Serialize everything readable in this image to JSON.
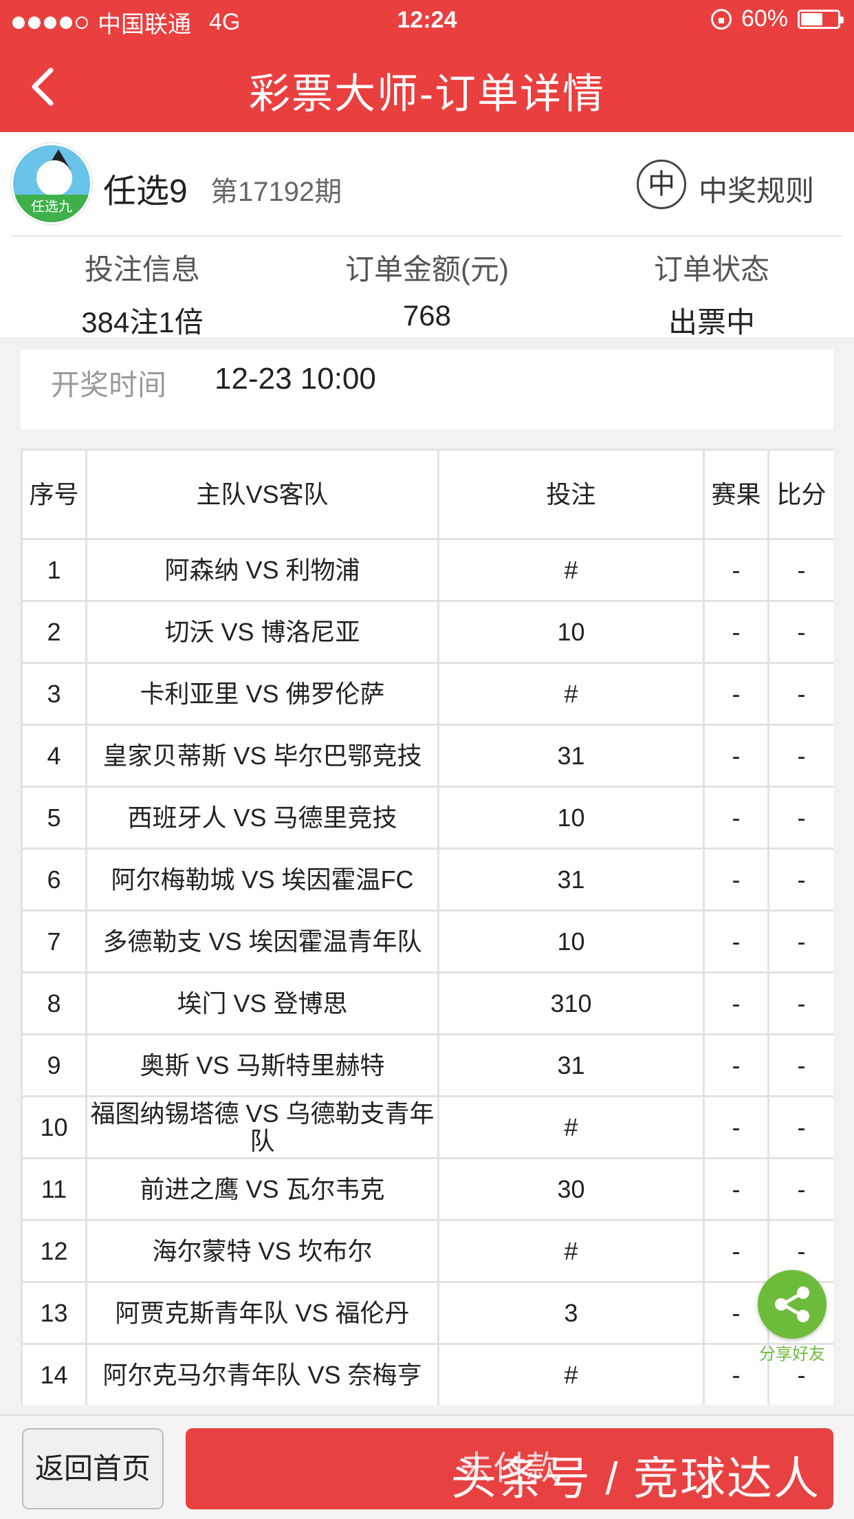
{
  "status_bar": {
    "carrier": "中国联通",
    "network": "4G",
    "time": "12:24",
    "battery": "60%",
    "battery_level": 0.6
  },
  "header": {
    "title": "彩票大师-订单详情"
  },
  "game": {
    "name": "任选9",
    "period": "第17192期",
    "rule_badge": "中",
    "rule_label": "中奖规则",
    "avatar_band_text": "任选九"
  },
  "order": {
    "bet_info_label": "投注信息",
    "bet_info_value": "384注1倍",
    "amount_label": "订单金额(元)",
    "amount_value": "768",
    "status_label": "订单状态",
    "status_value": "出票中"
  },
  "draw": {
    "label": "开奖时间",
    "value": "12-23 10:00"
  },
  "table": {
    "headers": [
      "序号",
      "主队VS客队",
      "投注",
      "赛果",
      "比分"
    ],
    "rows": [
      [
        "1",
        "阿森纳 VS 利物浦",
        "#",
        "-",
        "-"
      ],
      [
        "2",
        "切沃 VS 博洛尼亚",
        "10",
        "-",
        "-"
      ],
      [
        "3",
        "卡利亚里 VS 佛罗伦萨",
        "#",
        "-",
        "-"
      ],
      [
        "4",
        "皇家贝蒂斯 VS 毕尔巴鄂竞技",
        "31",
        "-",
        "-"
      ],
      [
        "5",
        "西班牙人 VS 马德里竞技",
        "10",
        "-",
        "-"
      ],
      [
        "6",
        "阿尔梅勒城 VS 埃因霍温FC",
        "31",
        "-",
        "-"
      ],
      [
        "7",
        "多德勒支 VS 埃因霍温青年队",
        "10",
        "-",
        "-"
      ],
      [
        "8",
        "埃门 VS 登博思",
        "310",
        "-",
        "-"
      ],
      [
        "9",
        "奥斯 VS 马斯特里赫特",
        "31",
        "-",
        "-"
      ],
      [
        "10",
        "福图纳锡塔德 VS 乌德勒支青年队",
        "#",
        "-",
        "-"
      ],
      [
        "11",
        "前进之鹰 VS 瓦尔韦克",
        "30",
        "-",
        "-"
      ],
      [
        "12",
        "海尔蒙特 VS 坎布尔",
        "#",
        "-",
        "-"
      ],
      [
        "13",
        "阿贾克斯青年队 VS 福伦丹",
        "3",
        "-",
        "-"
      ],
      [
        "14",
        "阿尔克马尔青年队 VS 奈梅亨",
        "#",
        "-",
        "-"
      ]
    ]
  },
  "share": {
    "label": "分享好友"
  },
  "footer": {
    "home_label": "返回首页",
    "pay_label": "去付款",
    "watermark": "头条号 / 竞球达人"
  },
  "colors": {
    "brand": "#ea3f3f",
    "share": "#6dbb3b"
  }
}
